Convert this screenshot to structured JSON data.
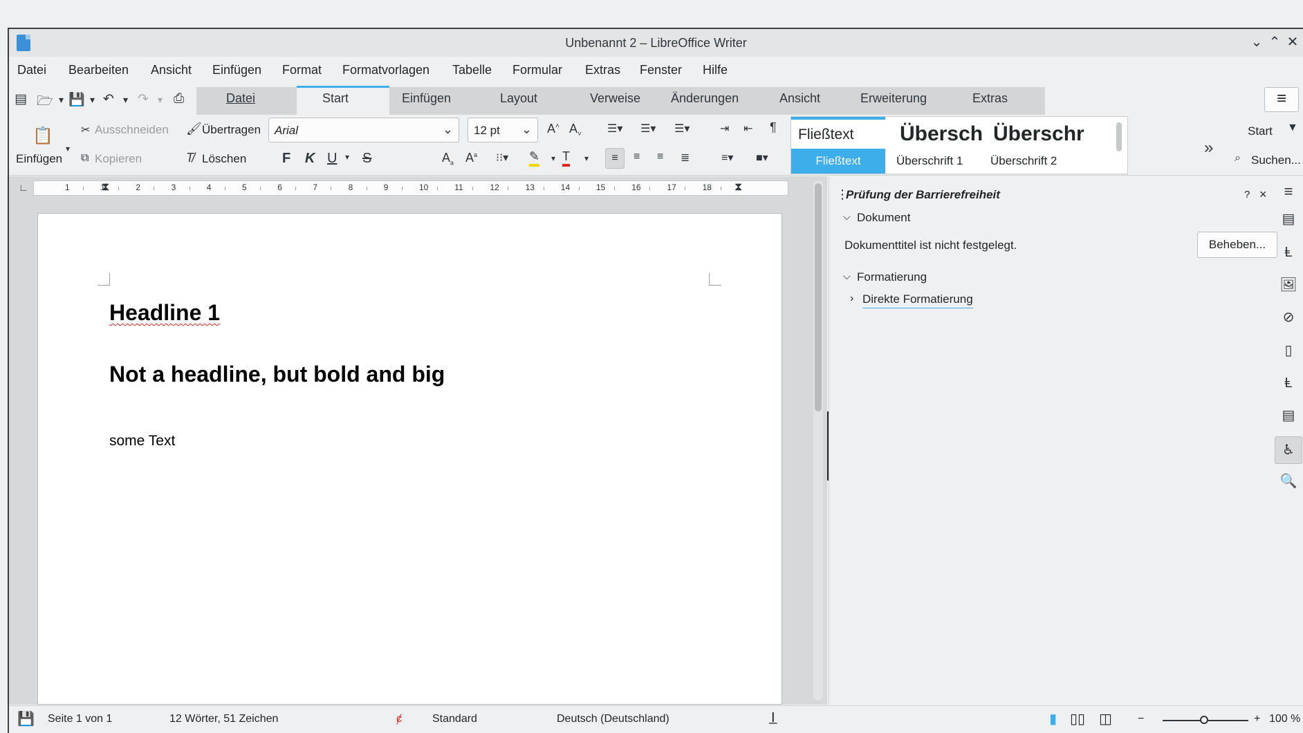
{
  "window": {
    "title": "Unbenannt 2 – LibreOffice Writer",
    "controls": {
      "minimize": "⌄",
      "maximize": "⌃",
      "close": "✕"
    }
  },
  "menubar": [
    "Datei",
    "Bearbeiten",
    "Ansicht",
    "Einfügen",
    "Format",
    "Formatvorlagen",
    "Tabelle",
    "Formular",
    "Extras",
    "Fenster",
    "Hilfe"
  ],
  "tabs": [
    {
      "label": "Datei",
      "active": false
    },
    {
      "label": "Start",
      "active": true
    },
    {
      "label": "Einfügen",
      "active": false
    },
    {
      "label": "Layout",
      "active": false
    },
    {
      "label": "Verweise",
      "active": false
    },
    {
      "label": "Änderungen",
      "active": false
    },
    {
      "label": "Ansicht",
      "active": false
    },
    {
      "label": "Erweiterung",
      "active": false
    },
    {
      "label": "Extras",
      "active": false
    }
  ],
  "ribbon": {
    "paste_label": "Einfügen",
    "cut_label": "Ausschneiden",
    "copy_label": "Kopieren",
    "clone_label": "Übertragen",
    "clear_label": "Löschen",
    "font_name": "Arial",
    "font_size": "12 pt",
    "bold": "F",
    "italic": "K",
    "underline": "U",
    "strike": "S",
    "styles": {
      "preview_default": "Fließtext",
      "preview_h1": "Übersch",
      "preview_h2": "Überschr",
      "label_default": "Fließtext",
      "label_h1": "Überschrift 1",
      "label_h2": "Überschrift 2"
    },
    "start_dropdown": "Start",
    "search_label": "Suchen..."
  },
  "ruler": {
    "marks": [
      "1",
      "1",
      "2",
      "3",
      "4",
      "5",
      "6",
      "7",
      "8",
      "9",
      "10",
      "11",
      "12",
      "13",
      "14",
      "15",
      "16",
      "17",
      "18"
    ]
  },
  "document": {
    "headline": "Headline 1",
    "bold_big": "Not a headline, but bold and big",
    "body_text": "some Text"
  },
  "sidebar": {
    "title": "Prüfung der Barrierefreiheit",
    "help": "?",
    "close": "×",
    "section_document": "Dokument",
    "issue_text": "Dokumenttitel ist nicht festgelegt.",
    "fix_button": "Beheben...",
    "section_formatting": "Formatierung",
    "subsection_direct": "Direkte Formatierung"
  },
  "statusbar": {
    "page": "Seite 1 von 1",
    "words": "12 Wörter, 51 Zeichen",
    "page_style": "Standard",
    "language": "Deutsch (Deutschland)",
    "zoom": "100 %",
    "zoom_minus": "−",
    "zoom_plus": "+"
  },
  "colors": {
    "accent": "#3daee9",
    "spell_error": "#e0241b"
  },
  "icons": [
    "app-icon",
    "save-icon",
    "undo-icon",
    "redo-icon",
    "print-icon",
    "paste-icon",
    "cut-icon",
    "copy-icon",
    "clone-icon",
    "clear-format-icon",
    "menu-icon",
    "search-icon",
    "navigator-icon",
    "properties-icon",
    "gallery-icon",
    "styles-icon",
    "page-icon",
    "inspector-icon",
    "accessibility-icon",
    "find-icon"
  ]
}
